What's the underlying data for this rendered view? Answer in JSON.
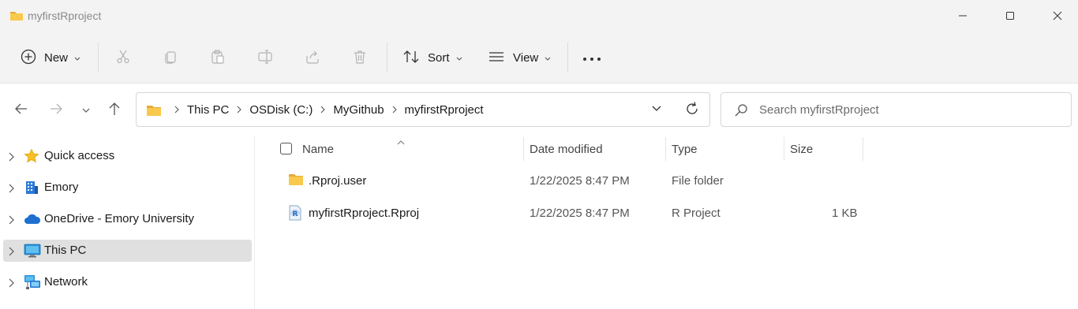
{
  "window": {
    "title": "myfirstRproject"
  },
  "toolbar": {
    "new_label": "New",
    "sort_label": "Sort",
    "view_label": "View",
    "icons": [
      "plus-circle-icon",
      "scissors-icon",
      "copy-icon",
      "paste-icon",
      "rename-icon",
      "share-icon",
      "trash-icon",
      "sort-icon",
      "view-lines-icon",
      "more-icon"
    ]
  },
  "address": {
    "crumbs": [
      "This PC",
      "OSDisk (C:)",
      "MyGithub",
      "myfirstRproject"
    ]
  },
  "search": {
    "placeholder": "Search myfirstRproject"
  },
  "sidebar": {
    "items": [
      {
        "label": "Quick access",
        "icon": "star-icon"
      },
      {
        "label": "Emory",
        "icon": "building-icon"
      },
      {
        "label": "OneDrive - Emory University",
        "icon": "cloud-icon"
      },
      {
        "label": "This PC",
        "icon": "monitor-icon",
        "selected": true
      },
      {
        "label": "Network",
        "icon": "network-icon"
      }
    ]
  },
  "columns": {
    "name": "Name",
    "date": "Date modified",
    "type": "Type",
    "size": "Size"
  },
  "files": [
    {
      "name": ".Rproj.user",
      "date": "1/22/2025 8:47 PM",
      "type": "File folder",
      "size": "",
      "icon": "folder-icon"
    },
    {
      "name": "myfirstRproject.Rproj",
      "date": "1/22/2025 8:47 PM",
      "type": "R Project",
      "size": "1 KB",
      "icon": "r-project-icon"
    }
  ],
  "colors": {
    "folder": "#f8c94c",
    "accent": "#0f6cbd",
    "selected_bg": "#e0e0e0",
    "chrome_bg": "#f3f3f3"
  }
}
